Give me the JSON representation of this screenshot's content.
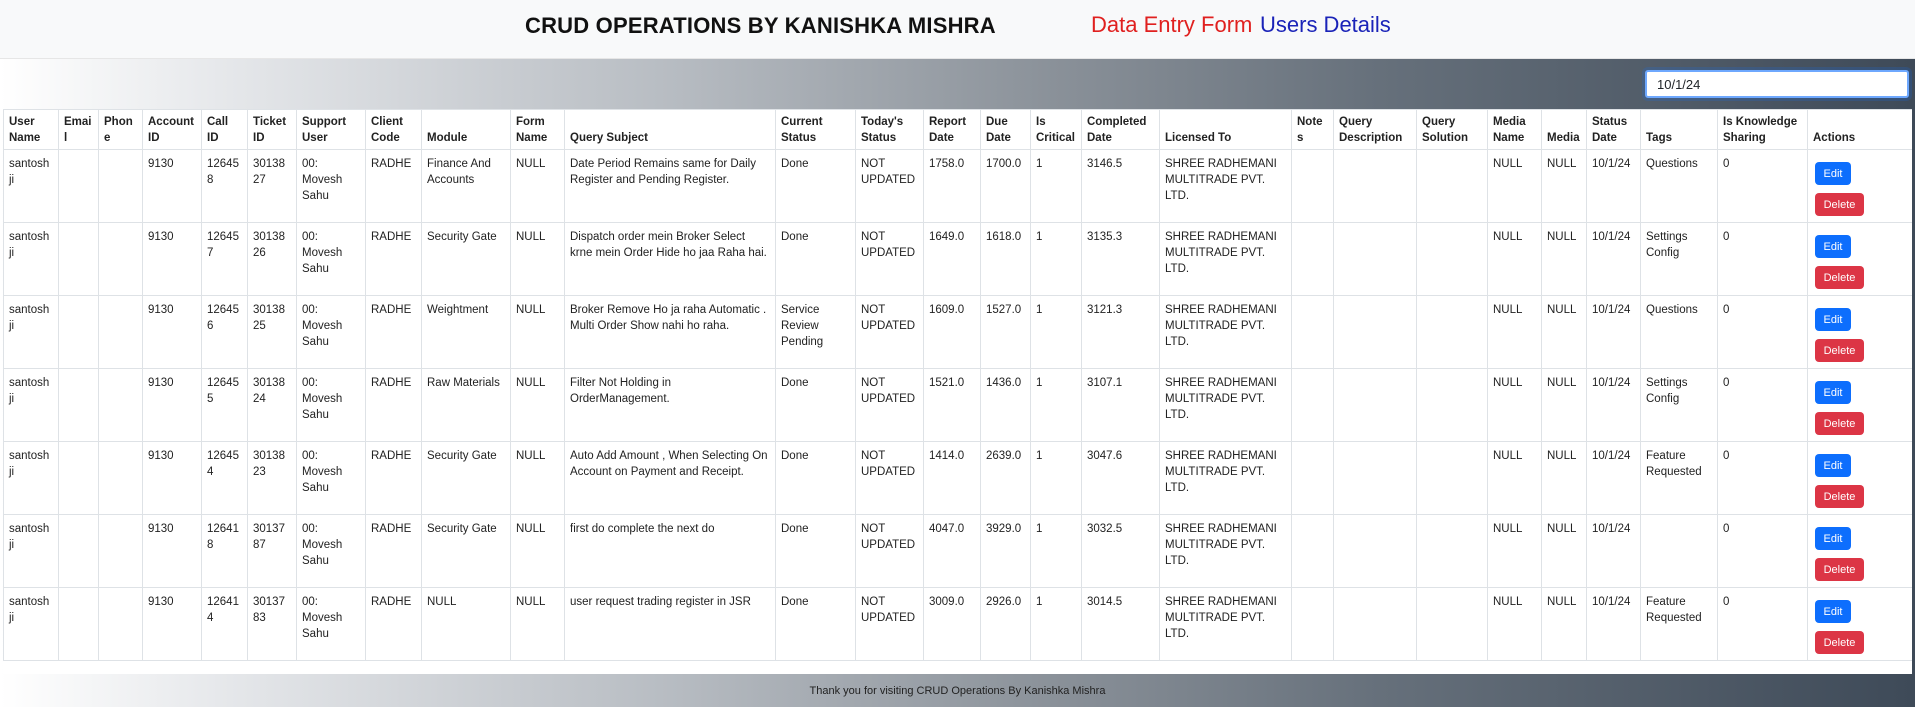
{
  "header": {
    "title": "CRUD OPERATIONS BY KANISHKA MISHRA",
    "nav": [
      {
        "label": "Data Entry Form",
        "color": "#e0201f"
      },
      {
        "label": "Users Details",
        "color": "#1a23b8"
      }
    ]
  },
  "search": {
    "value": "10/1/24",
    "placeholder": ""
  },
  "table": {
    "columns": [
      "User Name",
      "Email",
      "Phone",
      "Account ID",
      "Call ID",
      "Ticket ID",
      "Support User",
      "Client Code",
      "Module",
      "Form Name",
      "Query Subject",
      "Current Status",
      "Today's Status",
      "Report Date",
      "Due Date",
      "Is Critical",
      "Completed Date",
      "Licensed To",
      "Notes",
      "Query Description",
      "Query Solution",
      "Media Name",
      "Media",
      "Status Date",
      "Tags",
      "Is Knowledge Sharing",
      "Actions"
    ],
    "edit_label": "Edit",
    "delete_label": "Delete",
    "rows": [
      [
        "santosh ji",
        "",
        "",
        "9130",
        "126458",
        "3013827",
        "00: Movesh Sahu",
        "RADHE",
        "Finance And Accounts",
        "NULL",
        "Date Period Remains same for Daily Register and Pending Register.",
        "Done",
        "NOT UPDATED",
        "1758.0",
        "1700.0",
        "1",
        "3146.5",
        "SHREE RADHEMANI MULTITRADE PVT. LTD.",
        "",
        "",
        "",
        "NULL",
        "NULL",
        "10/1/24",
        "Questions",
        "0"
      ],
      [
        "santosh ji",
        "",
        "",
        "9130",
        "126457",
        "3013826",
        "00: Movesh Sahu",
        "RADHE",
        "Security Gate",
        "NULL",
        "Dispatch order mein Broker Select krne mein Order Hide ho jaa Raha hai.",
        "Done",
        "NOT UPDATED",
        "1649.0",
        "1618.0",
        "1",
        "3135.3",
        "SHREE RADHEMANI MULTITRADE PVT. LTD.",
        "",
        "",
        "",
        "NULL",
        "NULL",
        "10/1/24",
        "Settings Config",
        "0"
      ],
      [
        "santosh ji",
        "",
        "",
        "9130",
        "126456",
        "3013825",
        "00: Movesh Sahu",
        "RADHE",
        "Weightment",
        "NULL",
        "Broker Remove Ho ja raha Automatic . Multi Order Show nahi ho raha.",
        "Service Review Pending",
        "NOT UPDATED",
        "1609.0",
        "1527.0",
        "1",
        "3121.3",
        "SHREE RADHEMANI MULTITRADE PVT. LTD.",
        "",
        "",
        "",
        "NULL",
        "NULL",
        "10/1/24",
        "Questions",
        "0"
      ],
      [
        "santosh ji",
        "",
        "",
        "9130",
        "126455",
        "3013824",
        "00: Movesh Sahu",
        "RADHE",
        "Raw Materials",
        "NULL",
        "Filter Not Holding in OrderManagement.",
        "Done",
        "NOT UPDATED",
        "1521.0",
        "1436.0",
        "1",
        "3107.1",
        "SHREE RADHEMANI MULTITRADE PVT. LTD.",
        "",
        "",
        "",
        "NULL",
        "NULL",
        "10/1/24",
        "Settings Config",
        "0"
      ],
      [
        "santosh ji",
        "",
        "",
        "9130",
        "126454",
        "3013823",
        "00: Movesh Sahu",
        "RADHE",
        "Security Gate",
        "NULL",
        "Auto Add Amount , When Selecting On Account on Payment and Receipt.",
        "Done",
        "NOT UPDATED",
        "1414.0",
        "2639.0",
        "1",
        "3047.6",
        "SHREE RADHEMANI MULTITRADE PVT. LTD.",
        "",
        "",
        "",
        "NULL",
        "NULL",
        "10/1/24",
        "Feature Requested",
        "0"
      ],
      [
        "santosh ji",
        "",
        "",
        "9130",
        "126418",
        "3013787",
        "00: Movesh Sahu",
        "RADHE",
        "Security Gate",
        "NULL",
        "first do complete the next do",
        "Done",
        "NOT UPDATED",
        "4047.0",
        "3929.0",
        "1",
        "3032.5",
        "SHREE RADHEMANI MULTITRADE PVT. LTD.",
        "",
        "",
        "",
        "NULL",
        "NULL",
        "10/1/24",
        "",
        "0"
      ],
      [
        "santosh ji",
        "",
        "",
        "9130",
        "126414",
        "3013783",
        "00: Movesh Sahu",
        "RADHE",
        "NULL",
        "NULL",
        "user request trading register in JSR",
        "Done",
        "NOT UPDATED",
        "3009.0",
        "2926.0",
        "1",
        "3014.5",
        "SHREE RADHEMANI MULTITRADE PVT. LTD.",
        "",
        "",
        "",
        "NULL",
        "NULL",
        "10/1/24",
        "Feature Requested",
        "0"
      ]
    ]
  },
  "footer": {
    "text": "Thank you for visiting CRUD Operations By Kanishka Mishra"
  }
}
